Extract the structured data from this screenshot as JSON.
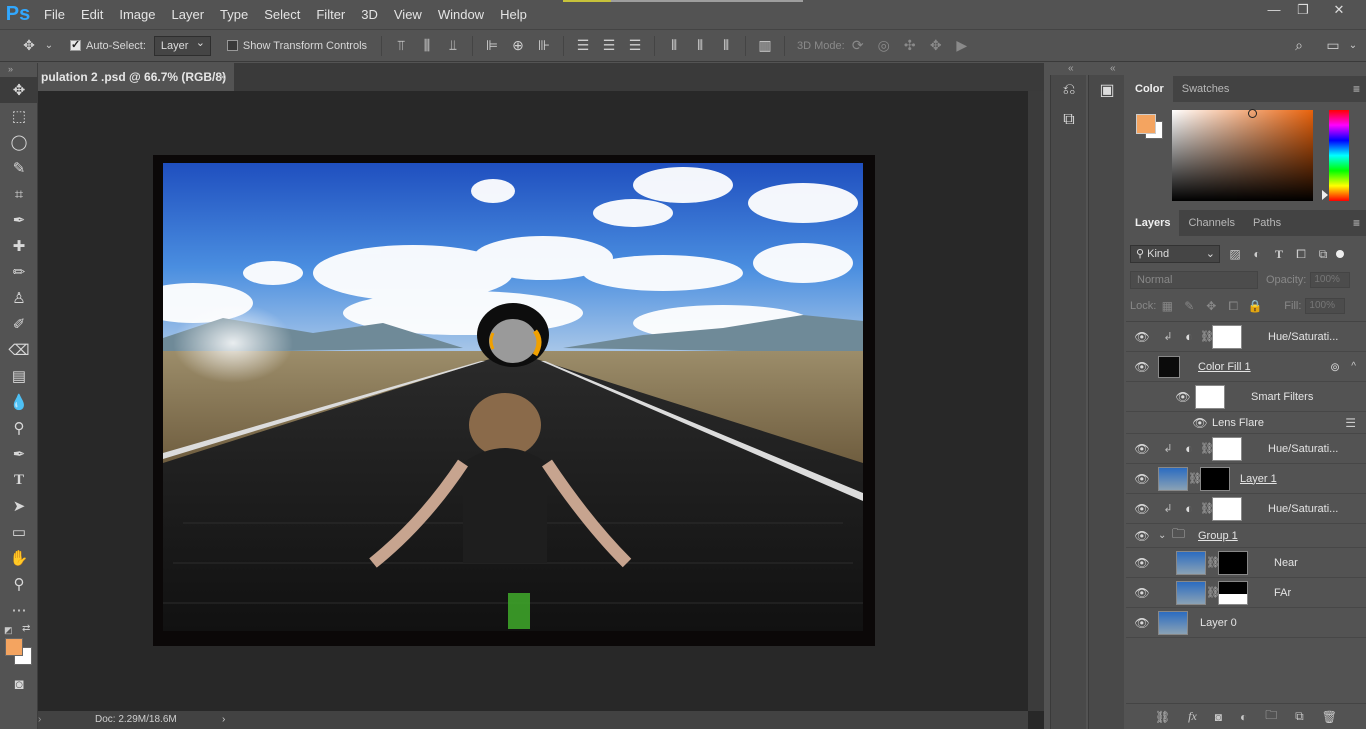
{
  "app": {
    "logo": "Ps"
  },
  "menu": [
    "File",
    "Edit",
    "Image",
    "Layer",
    "Type",
    "Select",
    "Filter",
    "3D",
    "View",
    "Window",
    "Help"
  ],
  "window_controls": {
    "minimize": "—",
    "restore": "❐",
    "close": "✕"
  },
  "options": {
    "auto_select_label": "Auto-Select:",
    "auto_select_checked": true,
    "auto_select_target": "Layer",
    "show_transform_label": "Show Transform Controls",
    "mode_3d_label": "3D Mode:"
  },
  "document": {
    "tab_title": "pulation 2 .psd @ 66.7% (RGB/8)",
    "close": "×",
    "status": "Doc: 2.29M/18.6M"
  },
  "color_panel": {
    "tabs": [
      "Color",
      "Swatches"
    ],
    "foreground": "#f4a460",
    "background": "#ffffff",
    "picker_hue": "#e8620c"
  },
  "layers_panel": {
    "tabs": [
      "Layers",
      "Channels",
      "Paths"
    ],
    "kind_label": "Kind",
    "blend_mode": "Normal",
    "opacity_label": "Opacity:",
    "opacity_value": "100%",
    "lock_label": "Lock:",
    "fill_label": "Fill:",
    "fill_value": "100%",
    "layers": [
      {
        "name": "Hue/Saturati...",
        "type": "adjustment",
        "clipped": true
      },
      {
        "name": "Color Fill 1",
        "type": "smart"
      },
      {
        "name": "Smart Filters",
        "type": "smart-filters"
      },
      {
        "name": "Lens Flare",
        "type": "filter"
      },
      {
        "name": "Hue/Saturati...",
        "type": "adjustment",
        "clipped": true
      },
      {
        "name": "Layer 1",
        "type": "pixel-mask"
      },
      {
        "name": "Hue/Saturati...",
        "type": "adjustment",
        "clipped": true
      },
      {
        "name": "Group 1",
        "type": "group"
      },
      {
        "name": "Near",
        "type": "pixel-mask"
      },
      {
        "name": "FAr",
        "type": "pixel-mask"
      },
      {
        "name": "Layer 0",
        "type": "pixel"
      }
    ]
  }
}
